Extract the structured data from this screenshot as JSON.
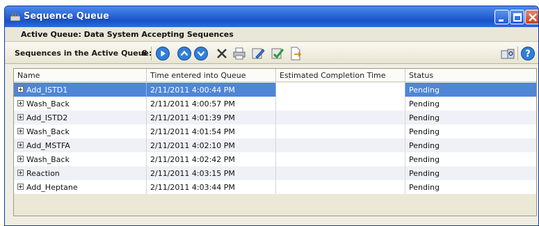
{
  "window": {
    "title": "Sequence Queue"
  },
  "queue": {
    "status_label": "Active Queue: Data System Accepting Sequences",
    "count_label": "Sequences in the Active Queue:",
    "count": "8"
  },
  "colors": {
    "titlebar": "#2a66d8",
    "selected_row": "#4f86d6",
    "panel_bg": "#ebe8d6"
  },
  "toolbar_icons": [
    "play-icon",
    "move-up-icon",
    "move-down-icon",
    "delete-icon",
    "print-icon",
    "edit-icon",
    "approve-icon",
    "export-icon",
    "view-icon",
    "help-icon"
  ],
  "table": {
    "columns": [
      "Name",
      "Time entered into Queue",
      "Estimated Completion Time",
      "Status"
    ],
    "rows": [
      {
        "name": "Add_ISTD1",
        "time": "2/11/2011 4:00:44 PM",
        "est": "",
        "status": "Pending"
      },
      {
        "name": "Wash_Back",
        "time": "2/11/2011 4:00:57 PM",
        "est": "",
        "status": "Pending"
      },
      {
        "name": "Add_ISTD2",
        "time": "2/11/2011 4:01:39 PM",
        "est": "",
        "status": "Pending"
      },
      {
        "name": "Wash_Back",
        "time": "2/11/2011 4:01:54 PM",
        "est": "",
        "status": "Pending"
      },
      {
        "name": "Add_MSTFA",
        "time": "2/11/2011 4:02:10 PM",
        "est": "",
        "status": "Pending"
      },
      {
        "name": "Wash_Back",
        "time": "2/11/2011 4:02:42 PM",
        "est": "",
        "status": "Pending"
      },
      {
        "name": "Reaction",
        "time": "2/11/2011 4:03:15 PM",
        "est": "",
        "status": "Pending"
      },
      {
        "name": "Add_Heptane",
        "time": "2/11/2011 4:03:44 PM",
        "est": "",
        "status": "Pending"
      }
    ]
  }
}
